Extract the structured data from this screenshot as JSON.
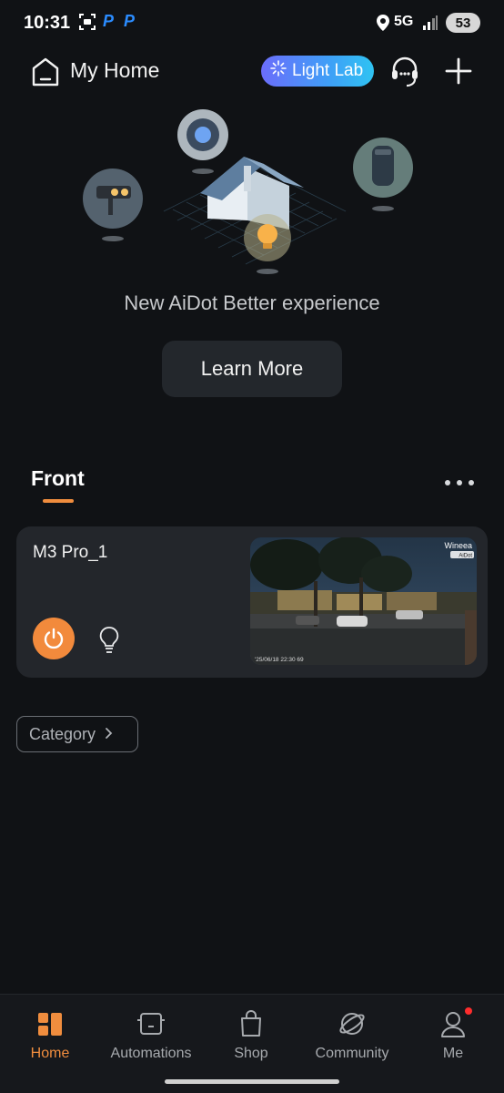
{
  "status_bar": {
    "time": "10:31",
    "p_badge_1": "P",
    "p_badge_2": "P",
    "network": "5G",
    "battery": "53"
  },
  "header": {
    "title": "My Home",
    "light_lab_label": "Light Lab"
  },
  "hero": {
    "tagline": "New AiDot Better experience",
    "learn_more_label": "Learn More"
  },
  "room": {
    "tab_label": "Front"
  },
  "device": {
    "name": "M3 Pro_1",
    "camera_brand": "Wineea",
    "camera_partner": "AiDot",
    "camera_timestamp": "'25/06/18  22:30  69"
  },
  "category": {
    "label": "Category"
  },
  "nav": {
    "items": [
      {
        "label": "Home"
      },
      {
        "label": "Automations"
      },
      {
        "label": "Shop"
      },
      {
        "label": "Community"
      },
      {
        "label": "Me"
      }
    ]
  },
  "colors": {
    "accent": "#f08d3e",
    "background": "#101215",
    "card": "#23262b",
    "notification": "#ff2d2d"
  }
}
